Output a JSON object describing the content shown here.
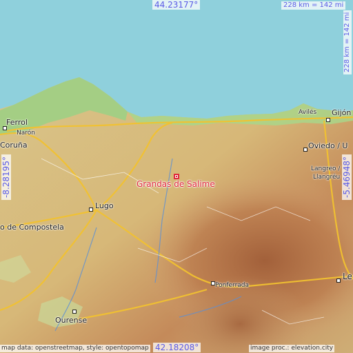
{
  "map": {
    "place": "Grandas de Salime",
    "coords": {
      "top": "44.23177°",
      "bottom": "42.18208°",
      "left": "-8.28195°",
      "right": "-5.46948°"
    },
    "scale": {
      "top": "228 km = 142 mi",
      "right": "228 km = 142 mi"
    },
    "attribution": {
      "left": "map data: openstreetmap, style: opentopomap",
      "right": "image proc.: elevation.city"
    },
    "cities": {
      "ferrol": "Ferrol",
      "naron": "Narón",
      "coruna": "Coruña",
      "aviles": "Avilés",
      "gijon": "Gijón",
      "oviedo": "Oviedo / U",
      "langreo": "Langreo /",
      "langreu": "Llangréu",
      "lugo": "Lugo",
      "compostela": "o de Compostela",
      "ponferrada": "Ponferrada",
      "ourense": "Ourense",
      "leon": "Le"
    },
    "colors": {
      "sea": "#8fd0dc",
      "marker": "#e0283c",
      "coord_text": "#5b5be6",
      "highway": "#f2c230",
      "lowland": "#9ecf84"
    }
  }
}
